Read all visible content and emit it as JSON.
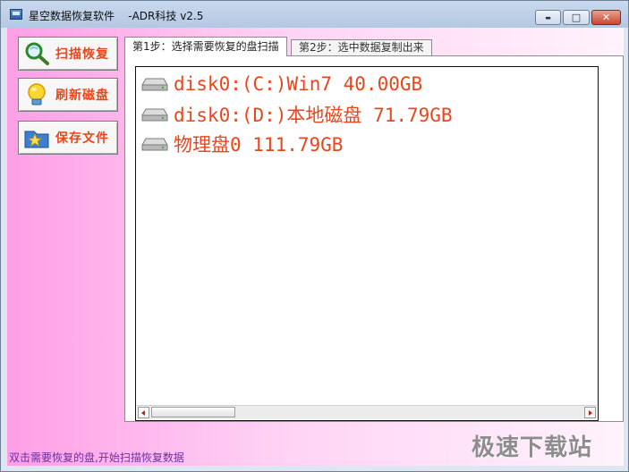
{
  "window": {
    "title": "星空数据恢复软件    -ADR科技 v2.5",
    "controls": {
      "minimize": "▬",
      "maximize": "□",
      "close": "✕"
    }
  },
  "sidebar": {
    "buttons": [
      {
        "label": "扫描恢复",
        "icon": "magnifier-icon"
      },
      {
        "label": "刷新磁盘",
        "icon": "lightbulb-icon"
      },
      {
        "label": "保存文件",
        "icon": "star-folder-icon"
      }
    ]
  },
  "tabs": [
    {
      "label": "第1步：选择需要恢复的盘扫描",
      "active": true
    },
    {
      "label": "第2步：选中数据复制出来",
      "active": false
    }
  ],
  "disks": [
    {
      "label": "disk0:(C:)Win7 40.00GB",
      "icon": "hard-drive-icon"
    },
    {
      "label": "disk0:(D:)本地磁盘 71.79GB",
      "icon": "hard-drive-icon"
    },
    {
      "label": "物理盘0 111.79GB",
      "icon": "hard-drive-icon"
    }
  ],
  "status": {
    "text": "双击需要恢复的盘,开始扫描恢复数据"
  },
  "watermark": {
    "text": "极速下载站"
  },
  "colors": {
    "accent_text": "#e8471d",
    "status_text": "#6a2fa0",
    "client_bg_start": "#ff9fe6",
    "client_bg_end": "#fff3fc"
  }
}
